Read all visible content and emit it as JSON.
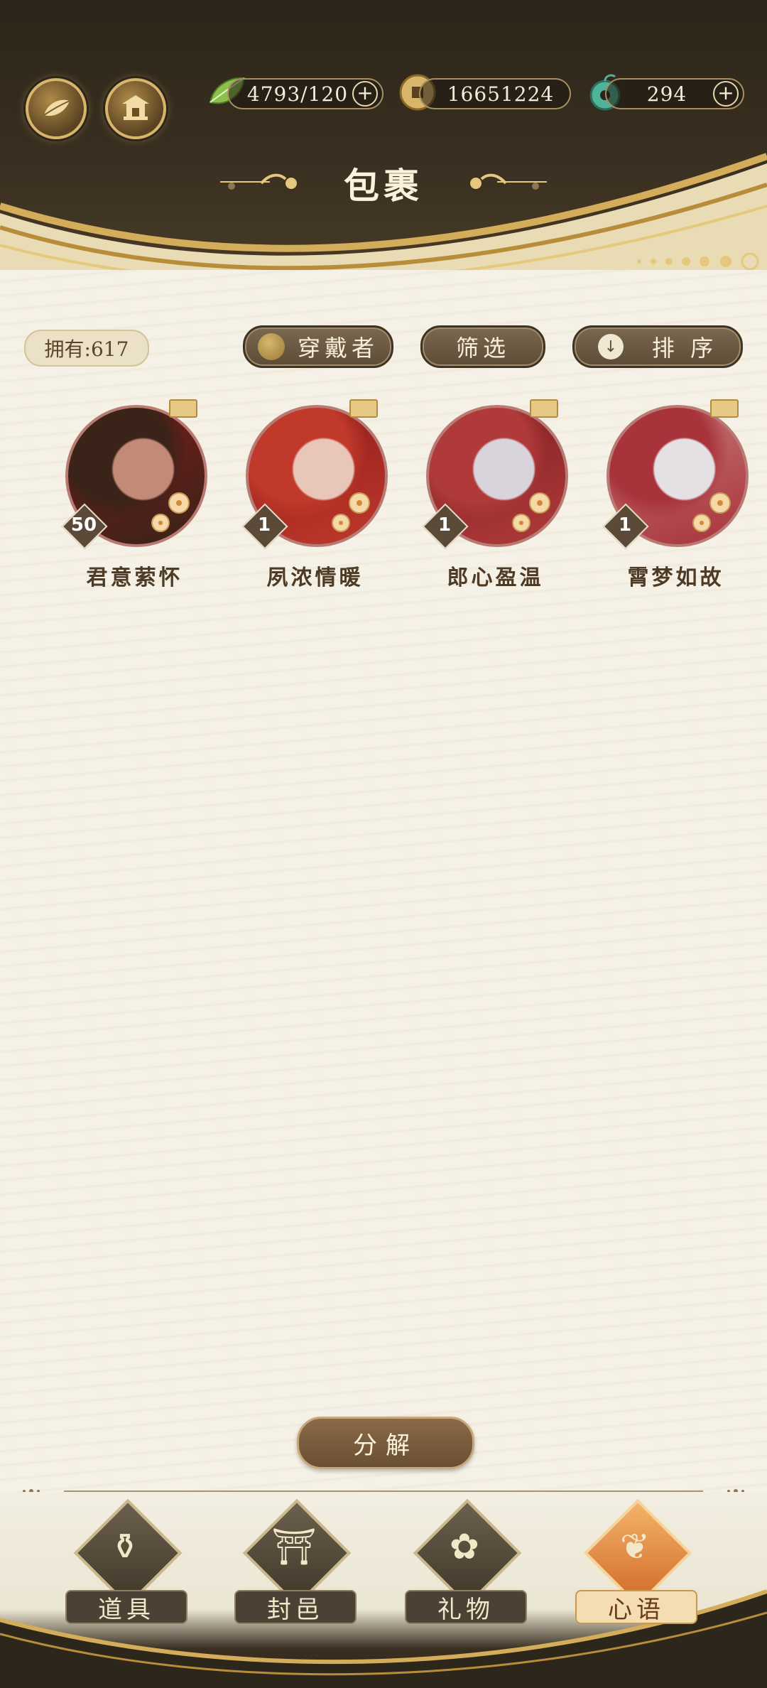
{
  "header": {
    "title": "包裹",
    "left_buttons": [
      {
        "icon": "leaf-emblem-icon"
      },
      {
        "icon": "pavilion-icon"
      }
    ],
    "resources": [
      {
        "icon": "green-leaf-icon",
        "value": "4793/120",
        "has_plus": true
      },
      {
        "icon": "copper-coin-icon",
        "value": "16651224",
        "has_plus": false
      },
      {
        "icon": "jade-pendant-icon",
        "value": "294",
        "has_plus": true
      }
    ]
  },
  "toolbar": {
    "owned_label": "拥有:617",
    "wearer_label": "穿戴者",
    "filter_label": "筛选",
    "sort_label": "排 序",
    "sort_icon": "↓"
  },
  "items": [
    {
      "name": "君意萦怀",
      "count": "50",
      "colors": [
        "#3a2318",
        "#c48a78",
        "#7a1c1c"
      ]
    },
    {
      "name": "夙浓情暖",
      "count": "1",
      "colors": [
        "#c0392b",
        "#e8c6b8",
        "#8b1a1a"
      ]
    },
    {
      "name": "郎心盈温",
      "count": "1",
      "colors": [
        "#b03a3a",
        "#d9d3dc",
        "#7d1f23"
      ]
    },
    {
      "name": "霄梦如故",
      "count": "1",
      "colors": [
        "#a8333b",
        "#e4e0e4",
        "#c67b7b"
      ]
    }
  ],
  "actions": {
    "decompose_label": "分解"
  },
  "bottom_tabs": [
    {
      "label": "道具",
      "glyph": "⚱",
      "active": false
    },
    {
      "label": "封邑",
      "glyph": "⛩",
      "active": false
    },
    {
      "label": "礼物",
      "glyph": "✿",
      "active": false
    },
    {
      "label": "心语",
      "glyph": "❦",
      "active": true
    }
  ],
  "colors": {
    "header_dark": "#2c2519",
    "gold": "#d9b56b",
    "paper": "#f3efe3",
    "active_orange": "#e0884a"
  }
}
